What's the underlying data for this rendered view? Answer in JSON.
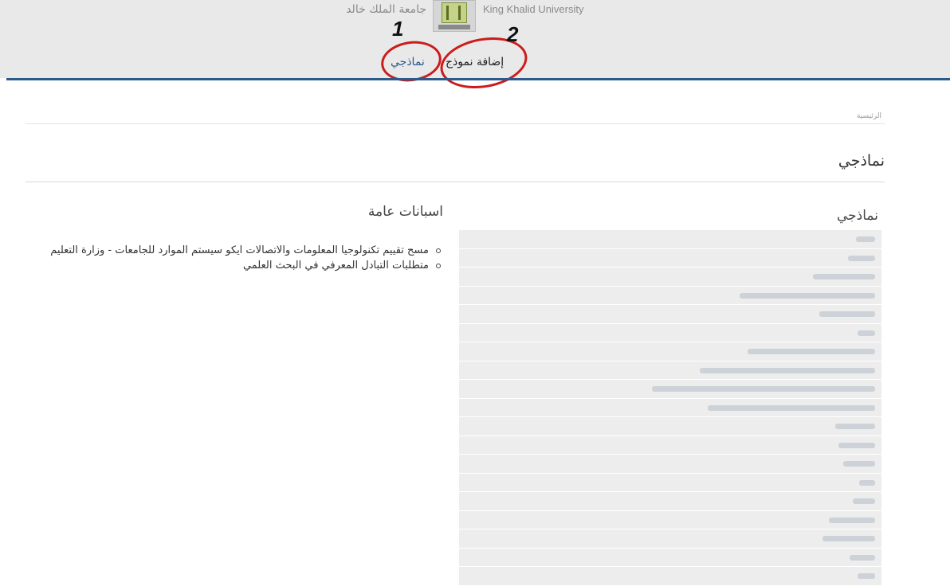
{
  "header": {
    "brand_ar": "جامعة الملك خالد",
    "brand_en": "King Khalid University",
    "nav": [
      {
        "label": "نماذجي"
      },
      {
        "label": "إضافة نموذج"
      }
    ],
    "annotations": [
      "1",
      "2"
    ]
  },
  "breadcrumb": "الرئيسية",
  "page_title": "نماذجي",
  "models_section": {
    "title": "نماذجي",
    "rows": 19
  },
  "surveys_section": {
    "title": "اسبانات عامة",
    "items": [
      "مسح تقييم تكنولوجيا المعلومات والاتصالات ايكو سيستم الموارد للجامعات - وزارة التعليم",
      "متطلبات التبادل المعرفي في البحث العلمي"
    ]
  },
  "colors": {
    "nav_active": "#2c5a8a",
    "header_bg": "#e9e9e9",
    "annotation_red": "#cc1b1b"
  }
}
